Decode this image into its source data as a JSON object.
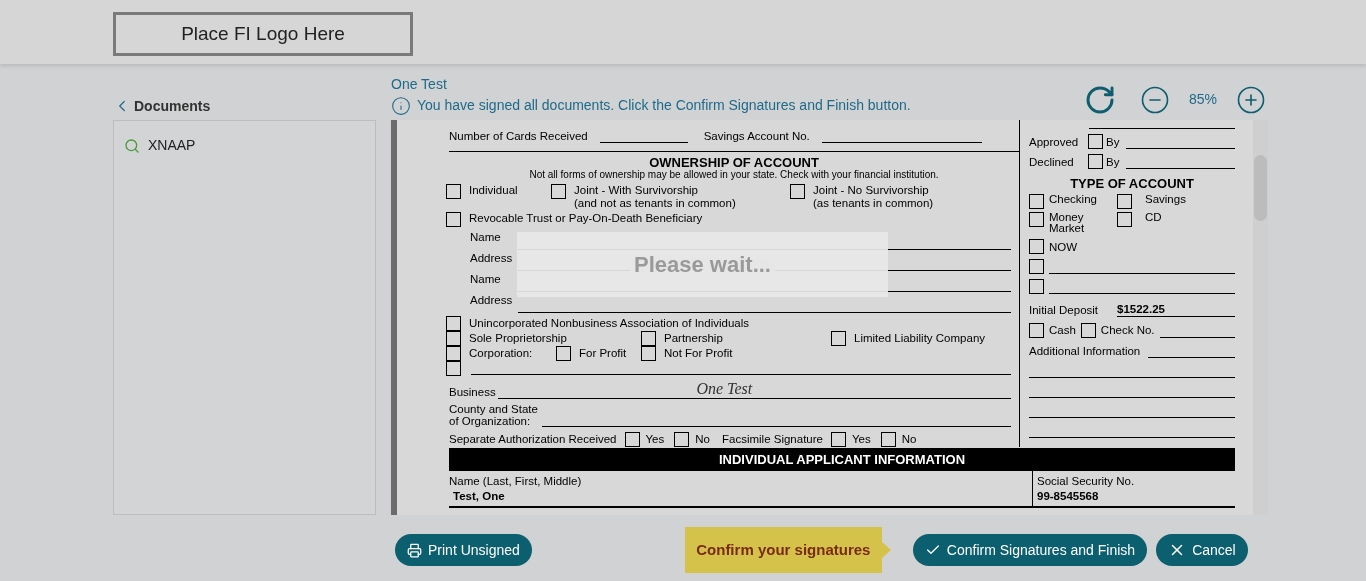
{
  "header": {
    "logo_placeholder": "Place FI Logo Here"
  },
  "sidebar": {
    "back_label": "Documents",
    "items": [
      {
        "label": "XNAAP"
      }
    ]
  },
  "viewer": {
    "document_name": "One Test",
    "notice": "You have signed all documents. Click the Confirm Signatures and Finish button.",
    "zoom": "85%"
  },
  "form": {
    "account_fields": [
      "Number of Cards Received",
      "Savings Account No."
    ],
    "ownership": {
      "title": "OWNERSHIP OF ACCOUNT",
      "note": "Not all forms of ownership may be allowed in your state. Check with your financial institution.",
      "options": [
        {
          "label": "Individual",
          "checked": false
        },
        {
          "label": "Joint - With Survivorship",
          "sublabel": "(and not as tenants in common)",
          "checked": false
        },
        {
          "label": "Joint - No Survivorship",
          "sublabel": "(as tenants in common)",
          "checked": false
        },
        {
          "label": "Revocable Trust or Pay-On-Death Beneficiary",
          "checked": false
        }
      ],
      "beneficiary_fields": [
        "Name",
        "Address",
        "Name",
        "Address"
      ],
      "business_rows": [
        [
          {
            "label": "Unincorporated Nonbusiness Association of Individuals",
            "checked": false
          }
        ],
        [
          {
            "label": "Sole Proprietorship",
            "checked": false
          },
          {
            "label": "Partnership",
            "checked": false
          },
          {
            "label": "Limited Liability Company",
            "checked": false
          }
        ],
        [
          {
            "label": "Corporation:",
            "checked": false
          },
          {
            "label": "For Profit",
            "checked": false
          },
          {
            "label": "Not For Profit",
            "checked": false
          }
        ],
        [
          {
            "checked": false
          }
        ]
      ]
    },
    "business": {
      "label": "Business",
      "signature": "One Test"
    },
    "county": {
      "label": "County and State\nof Organization:"
    },
    "authorization": {
      "label": "Separate Authorization Received",
      "options": [
        {
          "label": "Yes",
          "checked": false
        },
        {
          "label": "No",
          "checked": false
        }
      ]
    },
    "facsimile": {
      "label": "Facsimile Signature",
      "options": [
        {
          "label": "Yes",
          "checked": false
        },
        {
          "label": "No",
          "checked": false
        }
      ]
    },
    "approvals": [
      {
        "label": "Approved",
        "checked": false,
        "by": "By"
      },
      {
        "label": "Declined",
        "checked": false,
        "by": "By"
      }
    ],
    "type_of_account": {
      "title": "TYPE OF ACCOUNT",
      "options": [
        {
          "label": "Checking",
          "checked": false
        },
        {
          "label": "Savings",
          "checked": false
        },
        {
          "label": "Money\nMarket",
          "checked": false
        },
        {
          "label": "CD",
          "checked": false
        }
      ],
      "extra_options": [
        {
          "label": "NOW",
          "checked": false
        },
        {
          "checked": false
        },
        {
          "checked": false
        }
      ]
    },
    "initial_deposit": {
      "label": "Initial Deposit",
      "value": "$1522.25"
    },
    "payment": [
      {
        "label": "Cash",
        "checked": false
      },
      {
        "label": "Check No.",
        "checked": false
      }
    ],
    "additional_info": "Additional Information",
    "section_title": "INDIVIDUAL APPLICANT INFORMATION",
    "applicant": {
      "name_label": "Name (Last, First, Middle)",
      "name": "Test, One",
      "ssn_label": "Social Security No.",
      "ssn": "99-8545568"
    }
  },
  "overlay": {
    "message": "Please wait..."
  },
  "footer": {
    "print_button": "Print Unsigned",
    "hint": "Confirm your signatures",
    "confirm_button": "Confirm Signatures and Finish",
    "cancel_button": "Cancel"
  }
}
